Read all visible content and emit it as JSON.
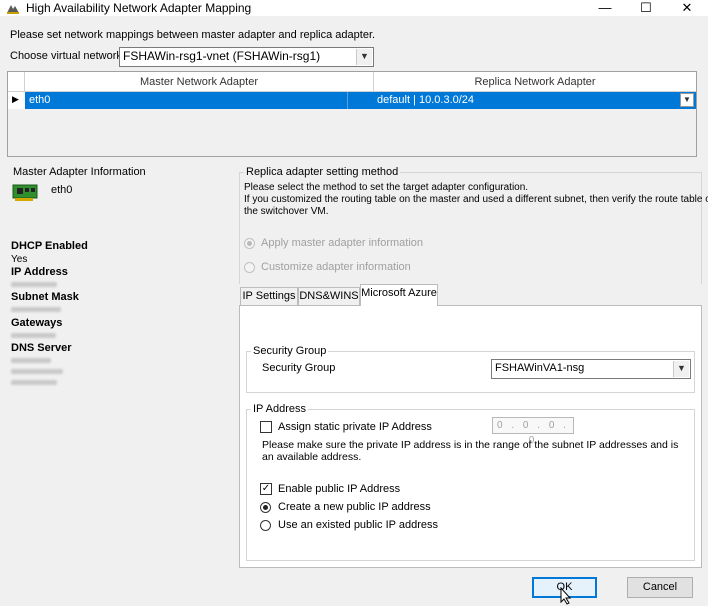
{
  "window": {
    "title": "High Availability Network Adapter Mapping",
    "minimize": "—",
    "maximize": "☐",
    "close": "✕"
  },
  "header": {
    "instruction": "Please set network mappings between master adapter and replica adapter.",
    "virtual_network_label": "Choose virtual network",
    "virtual_network_value": "FSHAWin-rsg1-vnet (FSHAWin-rsg1)"
  },
  "grid": {
    "col_master": "Master Network Adapter",
    "col_replica": "Replica Network Adapter",
    "row_master": "eth0",
    "row_replica": "default | 10.0.3.0/24"
  },
  "master_info": {
    "title": "Master Adapter Information",
    "adapter_name": "eth0",
    "dhcp_label": "DHCP Enabled",
    "dhcp_value": "Yes",
    "ip_label": "IP Address",
    "subnet_label": "Subnet Mask",
    "gateways_label": "Gateways",
    "dns_label": "DNS Server"
  },
  "replica_method": {
    "title": "Replica adapter setting method",
    "desc1": "Please select the method to set the target adapter configuration.",
    "desc2": "If you customized the routing table on the master and used a different subnet, then verify the route table of",
    "desc3": "the switchover VM.",
    "option_apply": "Apply master adapter information",
    "option_customize": "Customize adapter information"
  },
  "tabs": {
    "ip_settings": "IP Settings",
    "dns_wins": "DNS&WINS",
    "azure": "Microsoft Azure"
  },
  "security_group": {
    "group_title": "Security Group",
    "label": "Security Group",
    "value": "FSHAWinVA1-nsg"
  },
  "ip_address": {
    "group_title": "IP Address",
    "static_label": "Assign static private IP Address",
    "static_value": "0 . 0 . 0 . 0",
    "note1": "Please make sure the private IP address is in the range of the subnet IP addresses and is",
    "note2": "an available address.",
    "enable_public_label": "Enable public IP Address",
    "create_new_label": "Create a new public IP address",
    "use_existing_label": "Use an existed public IP address"
  },
  "buttons": {
    "ok": "OK",
    "cancel": "Cancel"
  }
}
